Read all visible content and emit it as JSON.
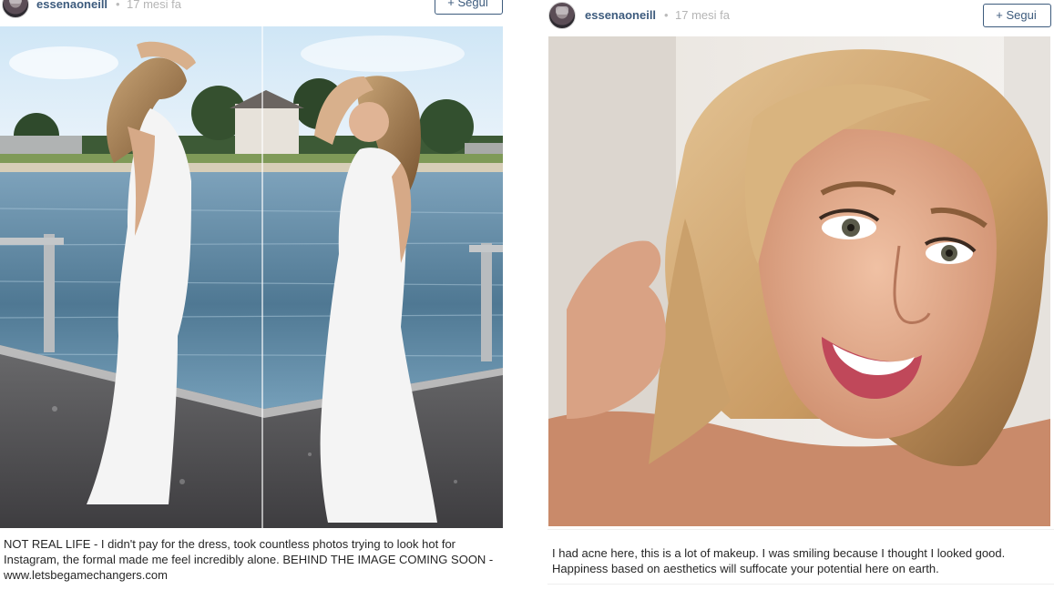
{
  "posts": [
    {
      "username": "essenaoneill",
      "time_separator": "•",
      "timestamp": "17 mesi fa",
      "follow_label": "+ Segui",
      "caption": "NOT REAL LIFE - I didn't pay for the dress, took countless photos trying to look hot for Instagram, the formal made me feel incredibly alone. BEHIND THE IMAGE COMING SOON - www.letsbegamechangers.com"
    },
    {
      "username": "essenaoneill",
      "time_separator": "•",
      "timestamp": "17 mesi fa",
      "follow_label": "+ Segui",
      "caption": "I had acne here, this is a lot of makeup. I was smiling because I thought I looked good. Happiness based on aesthetics will suffocate your potential here on earth."
    }
  ],
  "colors": {
    "username": "#3d5b7d",
    "timestamp": "#b5b5b5",
    "follow_border": "#3d5b7d",
    "caption_text": "#262626"
  }
}
